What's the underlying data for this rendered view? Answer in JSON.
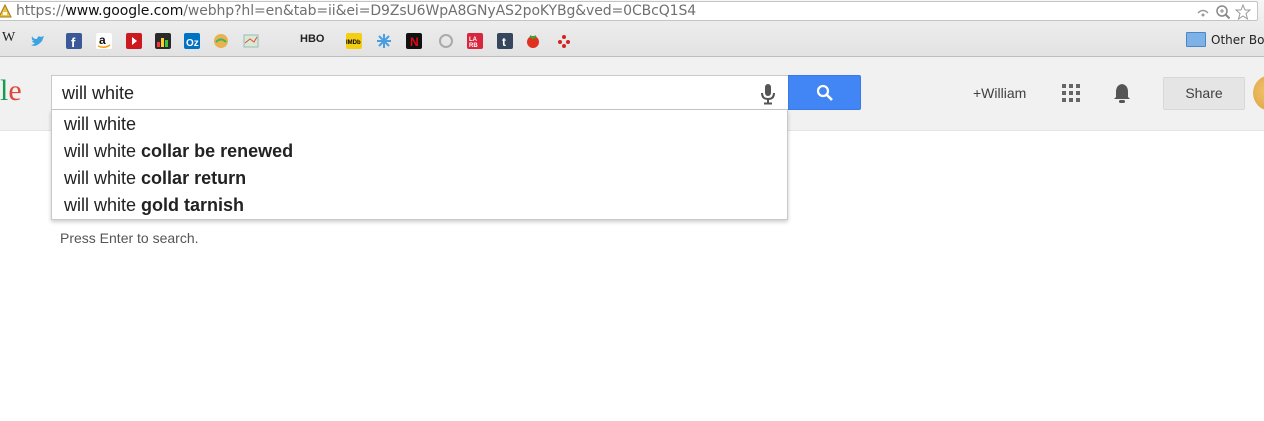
{
  "browser": {
    "url_prefix": "https://",
    "url_host": "www.google.com",
    "url_rest": "/webhp?hl=en&tab=ii&ei=D9ZsU6WpA8GNyAS2poKYBg&ved=0CBcQ1S4",
    "bookmarks": [
      "W",
      "twitter",
      "facebook",
      "amazon",
      "youtube",
      "wsj",
      "outlook",
      "finder",
      "maps",
      "HBO",
      "IMDb",
      "snowflake",
      "netflix",
      "circle",
      "LA RB",
      "tumblr",
      "tomato",
      "yelp"
    ],
    "hbo_label": "HBO",
    "other_bookmarks_label": "Other Bo"
  },
  "header": {
    "logo_fragment_l": "l",
    "logo_fragment_e": "e",
    "search_value": "will white",
    "user_label": "+William",
    "share_label": "Share"
  },
  "suggestions": [
    {
      "prefix": "will white",
      "completion": ""
    },
    {
      "prefix": "will white",
      "completion": "collar be renewed"
    },
    {
      "prefix": "will white",
      "completion": "collar return"
    },
    {
      "prefix": "will white",
      "completion": "gold tarnish"
    }
  ],
  "hint": "Press Enter to search.",
  "colors": {
    "accent_blue": "#4285f4",
    "logo_green": "#139d50",
    "logo_red": "#dd4a3b"
  }
}
